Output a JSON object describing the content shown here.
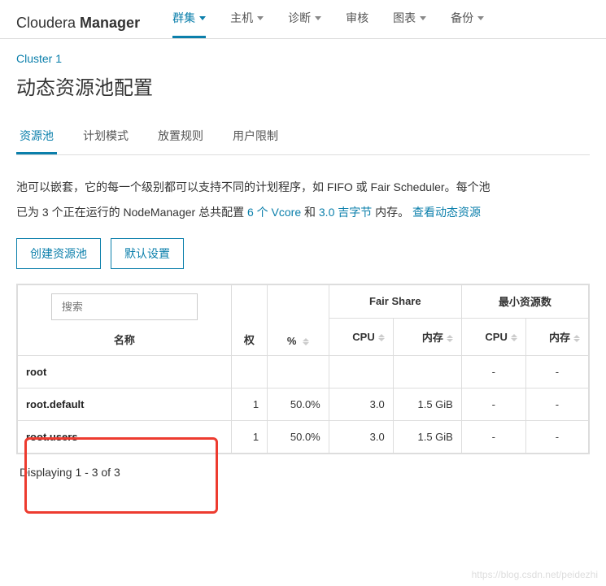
{
  "brand": {
    "part1": "Cloudera ",
    "part2": "Manager"
  },
  "topnav": [
    {
      "label": "群集",
      "active": true
    },
    {
      "label": "主机",
      "active": false
    },
    {
      "label": "诊断",
      "active": false
    },
    {
      "label": "审核",
      "active": false
    },
    {
      "label": "图表",
      "active": false
    },
    {
      "label": "备份",
      "active": false
    }
  ],
  "breadcrumb": "Cluster 1",
  "page_title": "动态资源池配置",
  "tabs": [
    {
      "label": "资源池",
      "active": true
    },
    {
      "label": "计划模式",
      "active": false
    },
    {
      "label": "放置规则",
      "active": false
    },
    {
      "label": "用户限制",
      "active": false
    }
  ],
  "desc": {
    "line1": "池可以嵌套，它的每一个级别都可以支持不同的计划程序，如 FIFO 或 Fair Scheduler。每个池",
    "line2_a": "已为 3 个正在运行的 NodeManager 总共配置 ",
    "vcore": "6 个 Vcore",
    "and": " 和 ",
    "mem": "3.0 吉字节",
    "line2_b": " 内存。  ",
    "link_view": "查看动态资源"
  },
  "buttons": {
    "create": "创建资源池",
    "defaults": "默认设置"
  },
  "table": {
    "search_placeholder": "搜索",
    "name_header": "名称",
    "weight_header": "权",
    "pct_header": "%",
    "group_fair": "Fair Share",
    "group_min": "最小资源数",
    "cpu_header": "CPU",
    "mem_header": "内存",
    "rows": [
      {
        "name": "root",
        "weight": "",
        "pct": "",
        "fs_cpu": "",
        "fs_mem": "",
        "min_cpu": "-",
        "min_mem": "-"
      },
      {
        "name": "root.default",
        "weight": "1",
        "pct": "50.0%",
        "fs_cpu": "3.0",
        "fs_mem": "1.5 GiB",
        "min_cpu": "-",
        "min_mem": "-"
      },
      {
        "name": "root.users",
        "weight": "1",
        "pct": "50.0%",
        "fs_cpu": "3.0",
        "fs_mem": "1.5 GiB",
        "min_cpu": "-",
        "min_mem": "-"
      }
    ]
  },
  "pager": "Displaying 1 - 3 of 3",
  "watermark": "https://blog.csdn.net/peidezhi"
}
